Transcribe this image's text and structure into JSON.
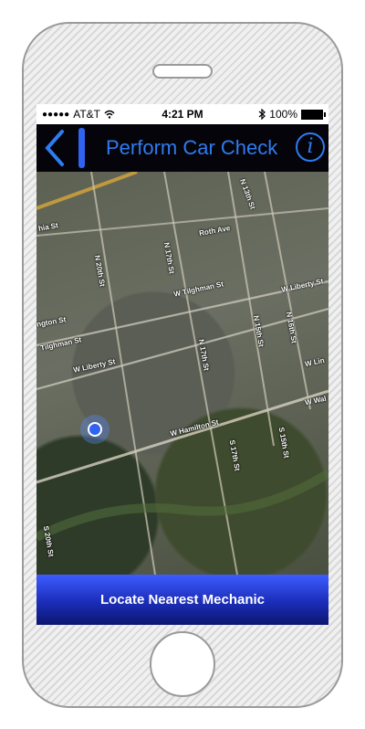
{
  "status_bar": {
    "signal_dots": "●●●●●",
    "carrier": "AT&T",
    "wifi_icon": "wifi-icon",
    "time": "4:21 PM",
    "bluetooth_icon": "bluetooth-icon",
    "battery_text": "100%",
    "battery_icon": "battery-icon"
  },
  "nav": {
    "back_icon": "chevron-left-icon",
    "title": "Perform Car Check",
    "info_label": "i",
    "accent_color": "#2f7bf0",
    "background_color": "#04040a"
  },
  "map": {
    "labels": [
      "hia St",
      "N 13th St",
      "Roth Ave",
      "N 20th St",
      "N 17th St",
      "W Tilghman St",
      "W Liberty St",
      "N 15th St",
      "N 16th St",
      "ngton St",
      "Tilghman St",
      "N 17th St",
      "W Liberty St",
      "W Lin",
      "W Wal",
      "W Hamilton St",
      "S 15th St",
      "S 17th St",
      "S 20th St",
      "N 14th St"
    ],
    "current_location_icon": "location-dot-icon"
  },
  "action": {
    "locate_label": "Locate Nearest Mechanic",
    "color_top": "#3d5cff",
    "color_bottom": "#0d1670"
  }
}
